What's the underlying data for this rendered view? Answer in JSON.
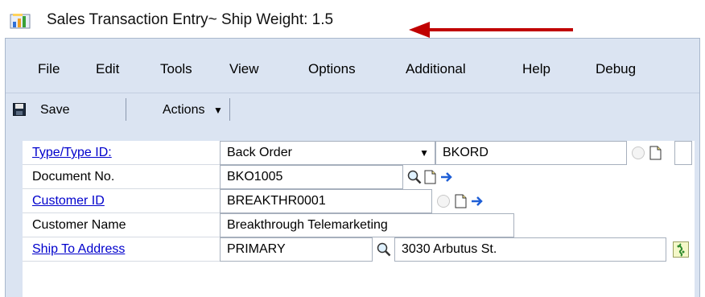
{
  "window": {
    "title": "Sales Transaction Entry~ Ship Weight: 1.5"
  },
  "menu": {
    "items": [
      "File",
      "Edit",
      "Tools",
      "View",
      "Options",
      "Additional",
      "Help",
      "Debug"
    ]
  },
  "toolbar": {
    "save_label": "Save",
    "actions_label": "Actions"
  },
  "form": {
    "type_label": "Type/Type ID:",
    "type_value": "Back Order",
    "type_id_value": "BKORD",
    "document_label": "Document No.",
    "document_value": "BKO1005",
    "customer_id_label": "Customer ID",
    "customer_id_value": "BREAKTHR0001",
    "customer_name_label": "Customer Name",
    "customer_name_value": "Breakthrough Telemarketing",
    "ship_to_label": "Ship To Address",
    "ship_to_value": "PRIMARY",
    "address_value": "3030 Arbutus St."
  },
  "colors": {
    "window_bg": "#dbe4f2",
    "link": "#0000cc",
    "annotation_arrow": "#c00000",
    "nav_arrow": "#1f5fd6"
  },
  "icons": [
    "app-icon",
    "floppy-disk-icon",
    "dropdown-caret-icon",
    "lookup-icon",
    "note-icon",
    "blank-note-icon",
    "expansion-arrow-icon",
    "address-map-icon"
  ]
}
